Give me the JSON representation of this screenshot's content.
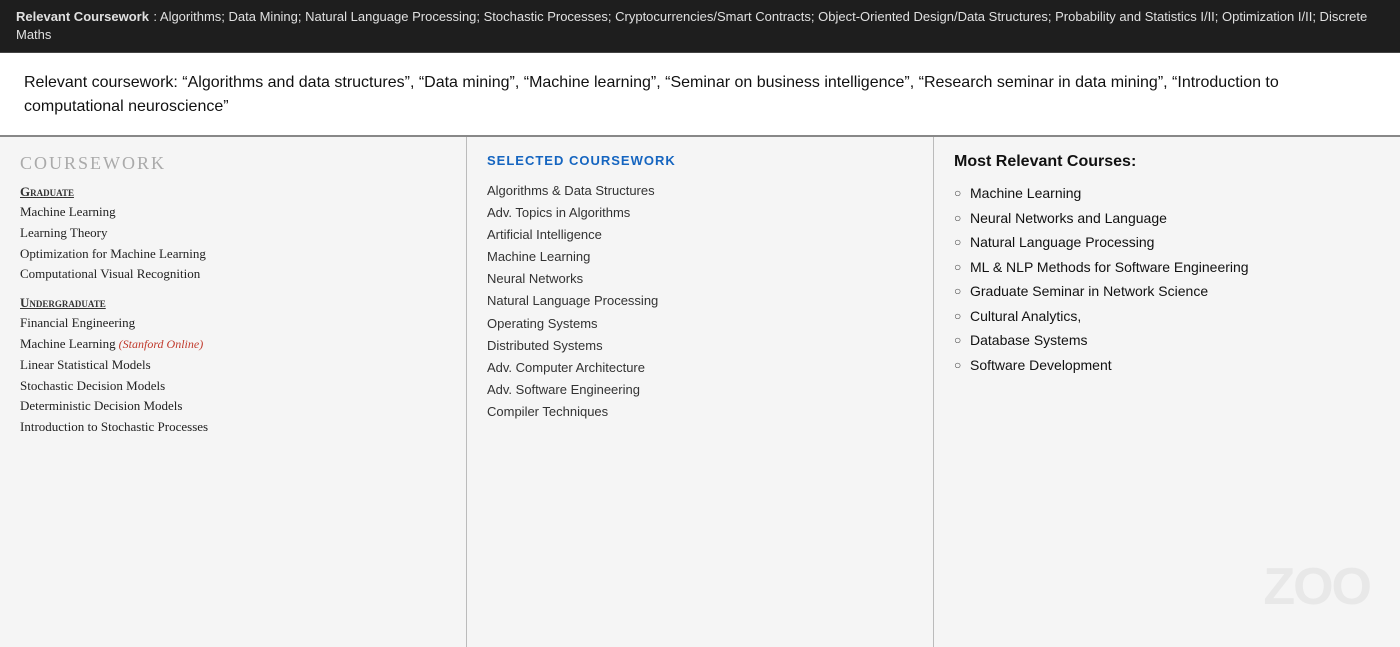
{
  "top_banner": {
    "label": "Relevant Coursework",
    "text": ": Algorithms; Data Mining; Natural Language Processing; Stochastic Processes; Cryptocurrencies/Smart Contracts; Object-Oriented Design/Data Structures; Probability and Statistics I/II; Optimization I/II; Discrete Maths"
  },
  "doc_area": {
    "text": "Relevant coursework:  “Algorithms and data structures”,  “Data mining”,  “Machine learning”, “Seminar on business intelligence”,  “Research seminar in data mining”,  “Introduction to computational neuroscience”"
  },
  "col1": {
    "title": "Coursework",
    "graduate_header": "Graduate",
    "graduate_courses": [
      "Machine Learning",
      "Learning Theory",
      "Optimization for Machine Learning",
      "Computational Visual Recognition"
    ],
    "undergraduate_header": "Undergraduate",
    "undergraduate_courses": [
      {
        "name": "Financial Engineering",
        "note": ""
      },
      {
        "name": "Machine Learning",
        "note": " (Stanford Online)"
      },
      {
        "name": "Linear Statistical Models",
        "note": ""
      },
      {
        "name": "Stochastic Decision Models",
        "note": ""
      },
      {
        "name": "Deterministic Decision Models",
        "note": ""
      },
      {
        "name": "Introduction to Stochastic Processes",
        "note": ""
      }
    ]
  },
  "col2": {
    "title": "Selected Coursework",
    "courses": [
      "Algorithms & Data Structures",
      "Adv. Topics in Algorithms",
      "Artificial Intelligence",
      "Machine Learning",
      "Neural Networks",
      "Natural Language Processing",
      "Operating Systems",
      "Distributed Systems",
      "Adv. Computer Architecture",
      "Adv. Software Engineering",
      "Compiler Techniques"
    ]
  },
  "col3": {
    "title": "Most Relevant Courses:",
    "courses": [
      "Machine Learning",
      "Neural Networks and Language",
      "Natural Language Processing",
      "ML & NLP Methods for Software Engineering",
      "Graduate Seminar in Network Science",
      "Cultural Analytics,",
      "Database Systems",
      "Software Development"
    ]
  },
  "watermark": {
    "text": "ZOO"
  }
}
